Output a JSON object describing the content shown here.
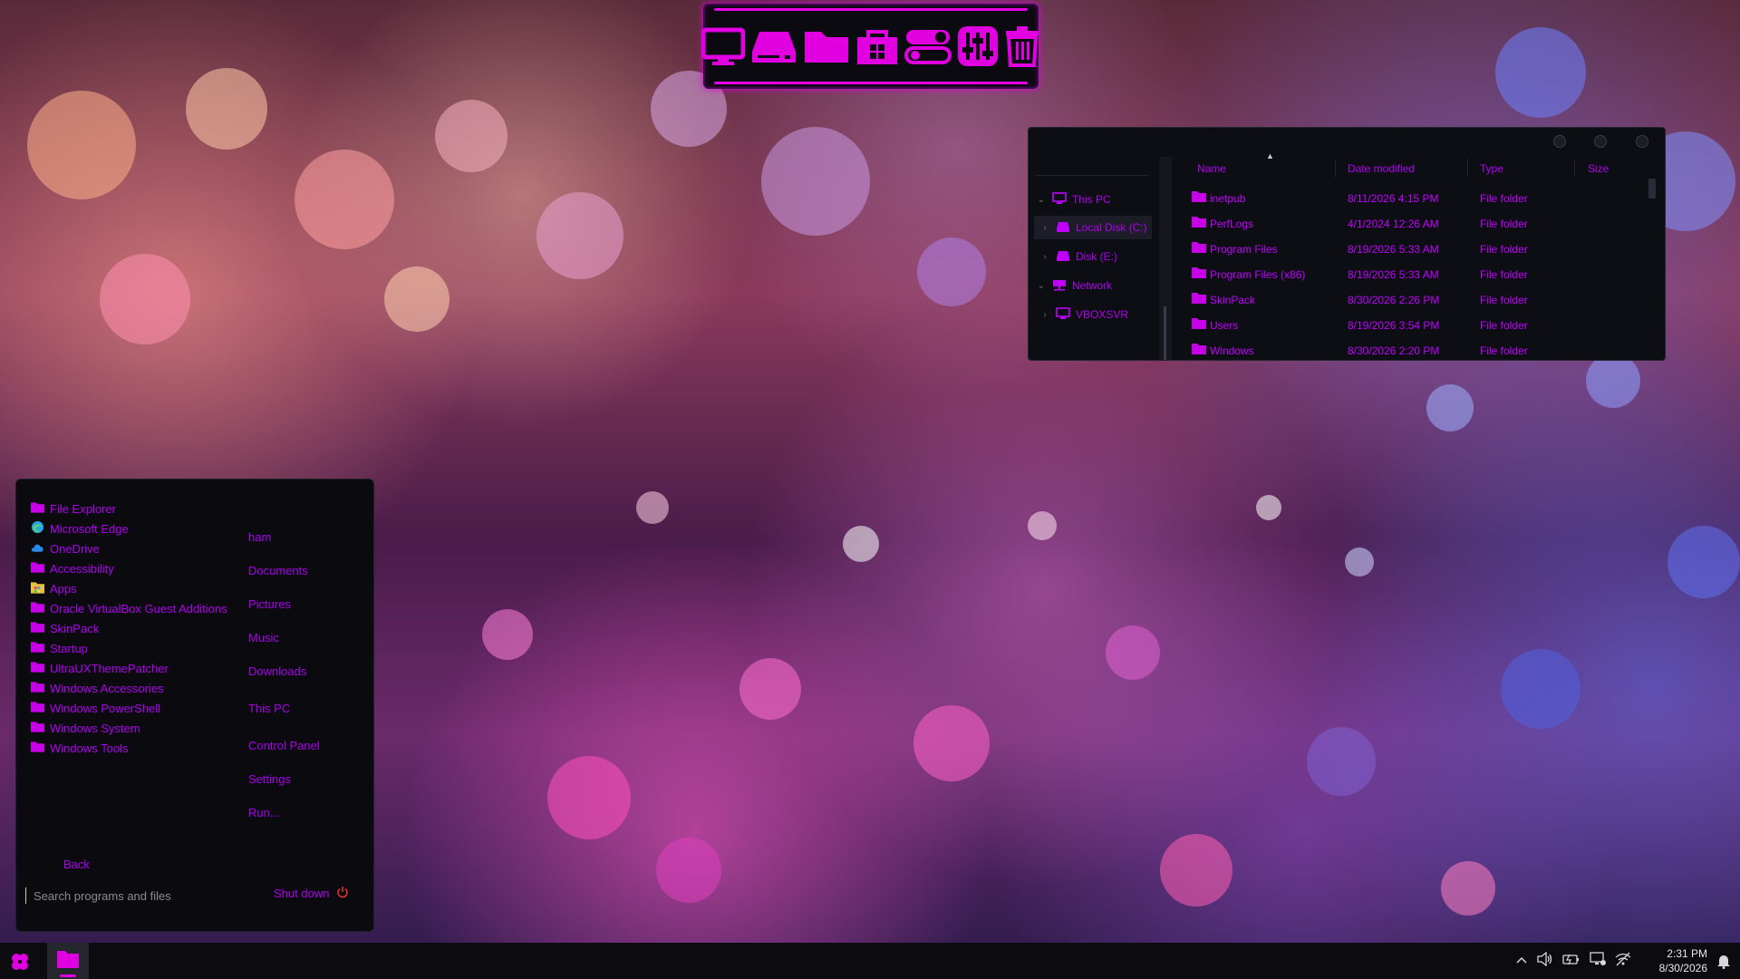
{
  "explorer": {
    "nav": [
      {
        "label": "This PC",
        "expanded": true
      },
      {
        "label": "Local Disk (C:)",
        "selected": true
      },
      {
        "label": "Disk (E:)"
      },
      {
        "label": "Network",
        "expanded": true
      },
      {
        "label": "VBOXSVR"
      }
    ],
    "columns": {
      "name": "Name",
      "date": "Date modified",
      "type": "Type",
      "size": "Size"
    },
    "files": [
      {
        "name": "inetpub",
        "date": "8/11/2026 4:15 PM",
        "type": "File folder"
      },
      {
        "name": "PerfLogs",
        "date": "4/1/2024 12:26 AM",
        "type": "File folder"
      },
      {
        "name": "Program Files",
        "date": "8/19/2026 5:33 AM",
        "type": "File folder"
      },
      {
        "name": "Program Files (x86)",
        "date": "8/19/2026 5:33 AM",
        "type": "File folder"
      },
      {
        "name": "SkinPack",
        "date": "8/30/2026 2:26 PM",
        "type": "File folder"
      },
      {
        "name": "Users",
        "date": "8/19/2026 3:54 PM",
        "type": "File folder"
      },
      {
        "name": "Windows",
        "date": "8/30/2026 2:20 PM",
        "type": "File folder"
      }
    ]
  },
  "start_menu": {
    "programs": [
      {
        "label": "File Explorer",
        "icon": "folder-icon"
      },
      {
        "label": "Microsoft Edge",
        "icon": "edge-icon"
      },
      {
        "label": "OneDrive",
        "icon": "cloud-icon"
      },
      {
        "label": "Accessibility",
        "icon": "folder-icon"
      },
      {
        "label": "Apps",
        "icon": "apps-icon"
      },
      {
        "label": "Oracle VirtualBox Guest Additions",
        "icon": "folder-icon"
      },
      {
        "label": "SkinPack",
        "icon": "folder-icon"
      },
      {
        "label": "Startup",
        "icon": "folder-icon"
      },
      {
        "label": "UltraUXThemePatcher",
        "icon": "folder-icon"
      },
      {
        "label": "Windows Accessories",
        "icon": "folder-icon"
      },
      {
        "label": "Windows PowerShell",
        "icon": "folder-icon"
      },
      {
        "label": "Windows System",
        "icon": "folder-icon"
      },
      {
        "label": "Windows Tools",
        "icon": "folder-icon"
      }
    ],
    "places": [
      "ham",
      "Documents",
      "Pictures",
      "Music",
      "Downloads",
      "This PC",
      "Control Panel",
      "Settings",
      "Run..."
    ],
    "back_label": "Back",
    "search_placeholder": "Search programs and files",
    "shutdown_label": "Shut down"
  },
  "taskbar": {
    "time": "2:31 PM",
    "date": "8/30/2026"
  },
  "colors": {
    "accent": "#c000ff",
    "folder": "#c800e8",
    "dock_glow": "#e600e6"
  }
}
